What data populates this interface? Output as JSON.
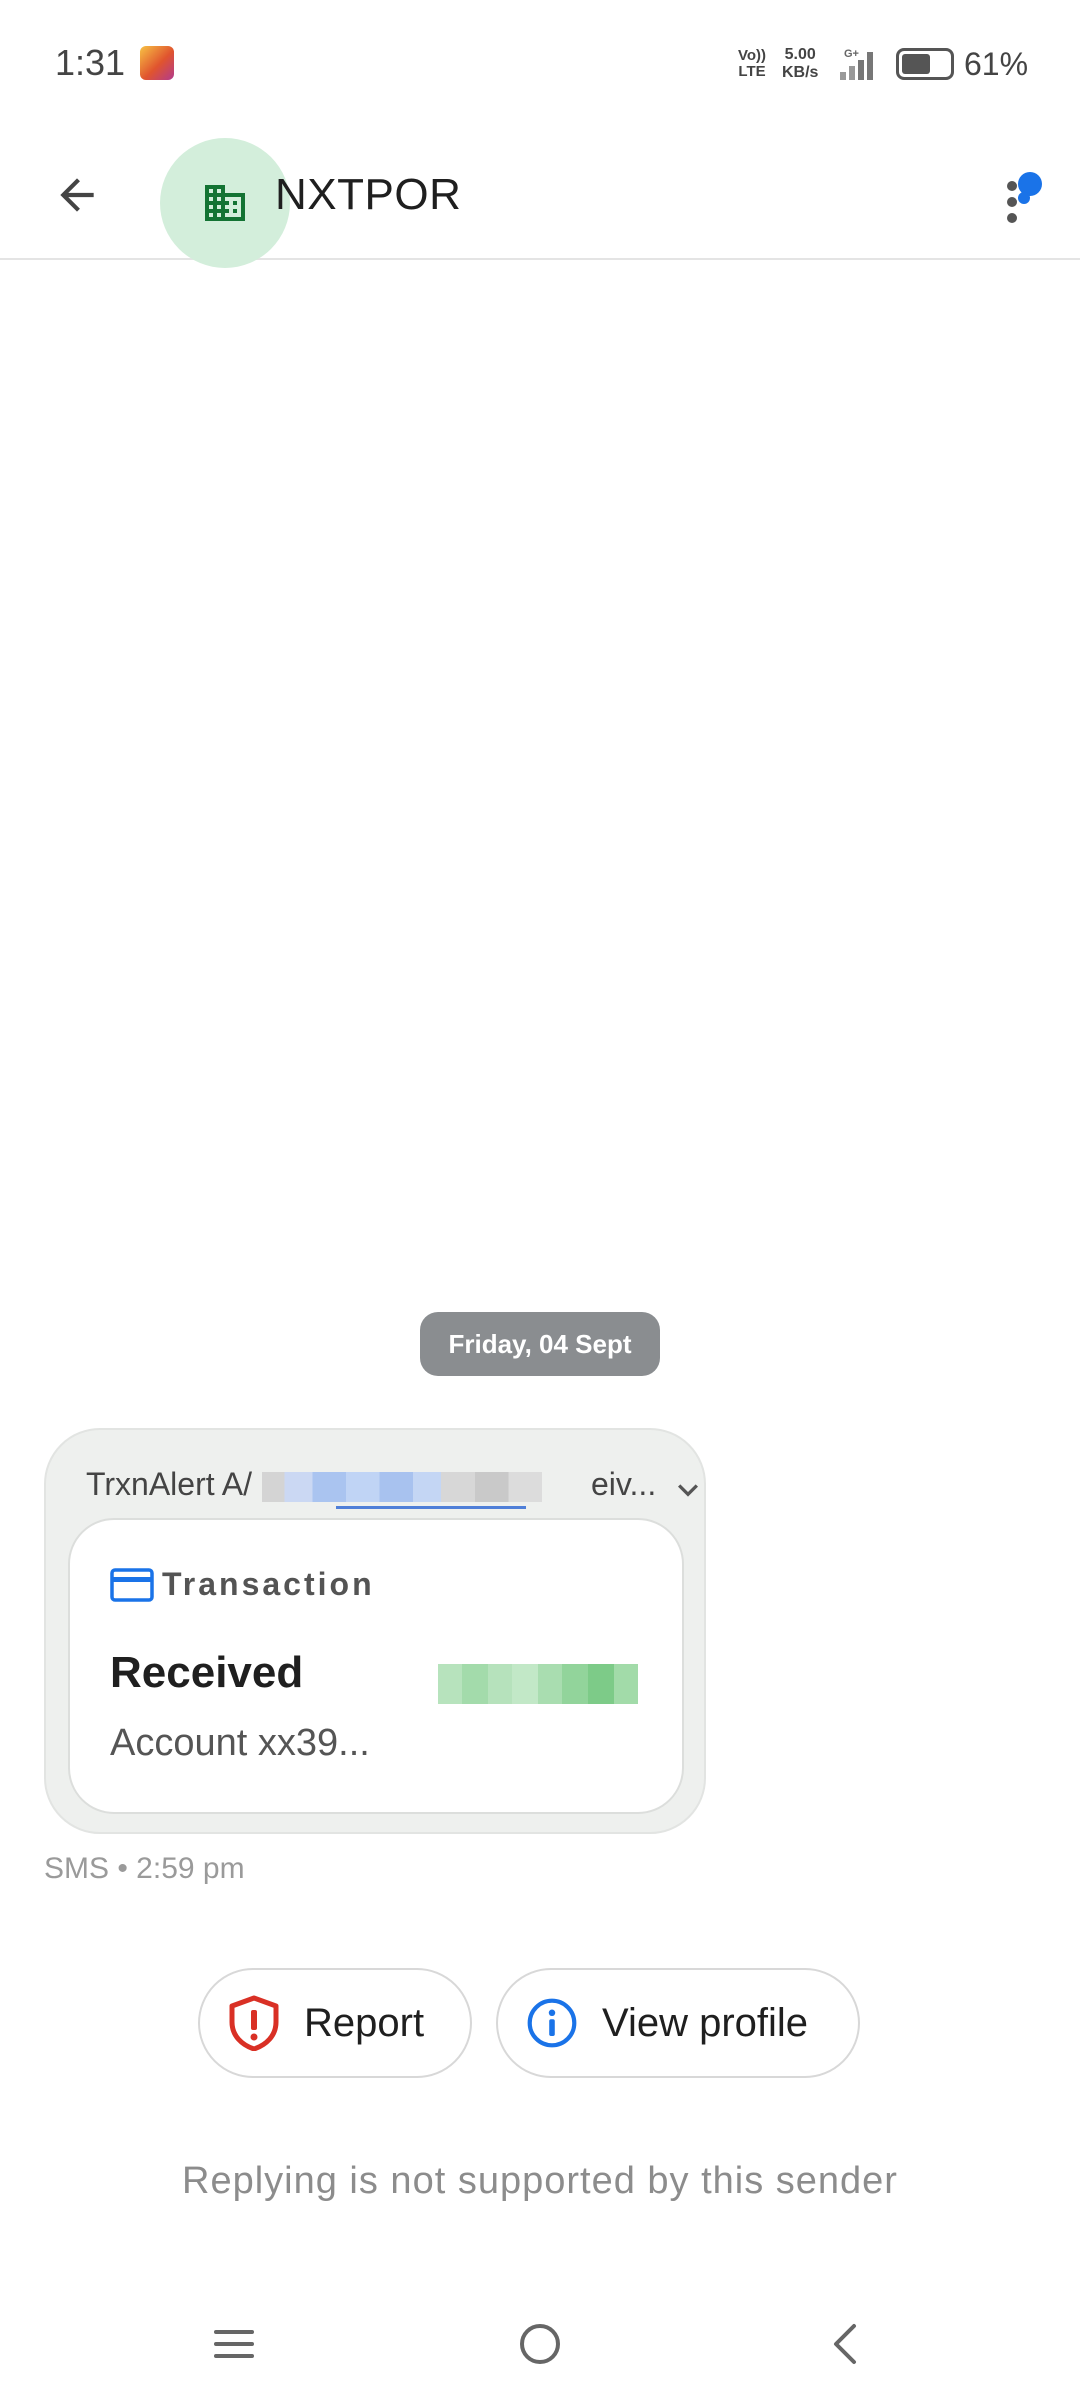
{
  "status_bar": {
    "time": "1:31",
    "volte_line1": "Vo))",
    "volte_line2": "LTE",
    "speed_value": "5.00",
    "speed_unit": "KB/s",
    "network_type": "G+",
    "battery_percent": "61%",
    "battery_level": 0.61
  },
  "app_bar": {
    "sender_name": "NXTPOR",
    "avatar_icon": "building-icon",
    "back_icon": "arrow-left-icon",
    "menu_icon": "more-vert-icon"
  },
  "conversation": {
    "date_chip": "Friday, 04 Sept",
    "message": {
      "preview_prefix": "TrxnAlert A/",
      "preview_suffix": "eiv...",
      "card": {
        "category": "Transaction",
        "category_icon": "credit-card-icon",
        "title": "Received",
        "subtitle": "Account xx39..."
      },
      "meta": "SMS • 2:59 pm"
    }
  },
  "actions": {
    "report_label": "Report",
    "view_profile_label": "View profile"
  },
  "reply_note": "Replying is not supported by this sender",
  "colors": {
    "accent_blue": "#1a73e8",
    "report_red": "#d93025",
    "avatar_bg": "#d3eedb",
    "avatar_icon": "#137333",
    "date_chip_bg": "#8a8d90",
    "bubble_bg": "#eef0ee"
  }
}
